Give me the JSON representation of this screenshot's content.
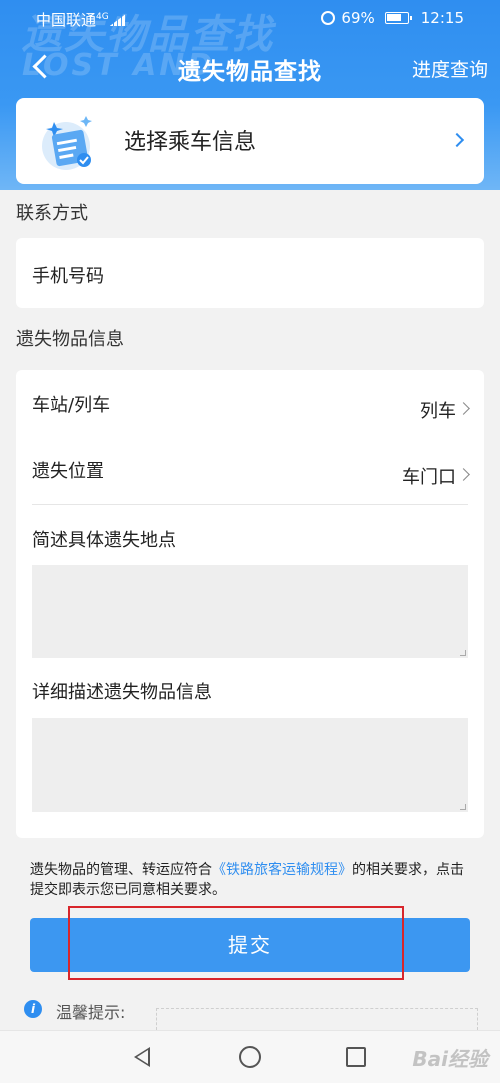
{
  "status": {
    "carrier": "中国联通",
    "carrier_sub": "4G",
    "battery": "69%",
    "time": "12:15"
  },
  "header": {
    "watermark_cn": "遗失物品查找",
    "watermark_en": "LOST AND",
    "title": "遗失物品查找",
    "right_link": "进度查询"
  },
  "ride": {
    "label": "选择乘车信息"
  },
  "contact": {
    "section_title": "联系方式",
    "phone_label": "手机号码"
  },
  "item_info": {
    "section_title": "遗失物品信息",
    "station_label": "车站/列车",
    "station_value": "列车",
    "location_label": "遗失位置",
    "location_value": "车门口",
    "brief_label": "简述具体遗失地点",
    "detail_label": "详细描述遗失物品信息"
  },
  "notice": {
    "prefix": "遗失物品的管理、转运应符合",
    "link": "《铁路旅客运输规程》",
    "suffix": "的相关要求，点击提交即表示您已同意相关要求。"
  },
  "submit_label": "提交",
  "tip_label": "温馨提示:",
  "watermark_bottom": "Bai经验",
  "colors": {
    "primary": "#3c97f1",
    "highlight": "#d8262c"
  }
}
